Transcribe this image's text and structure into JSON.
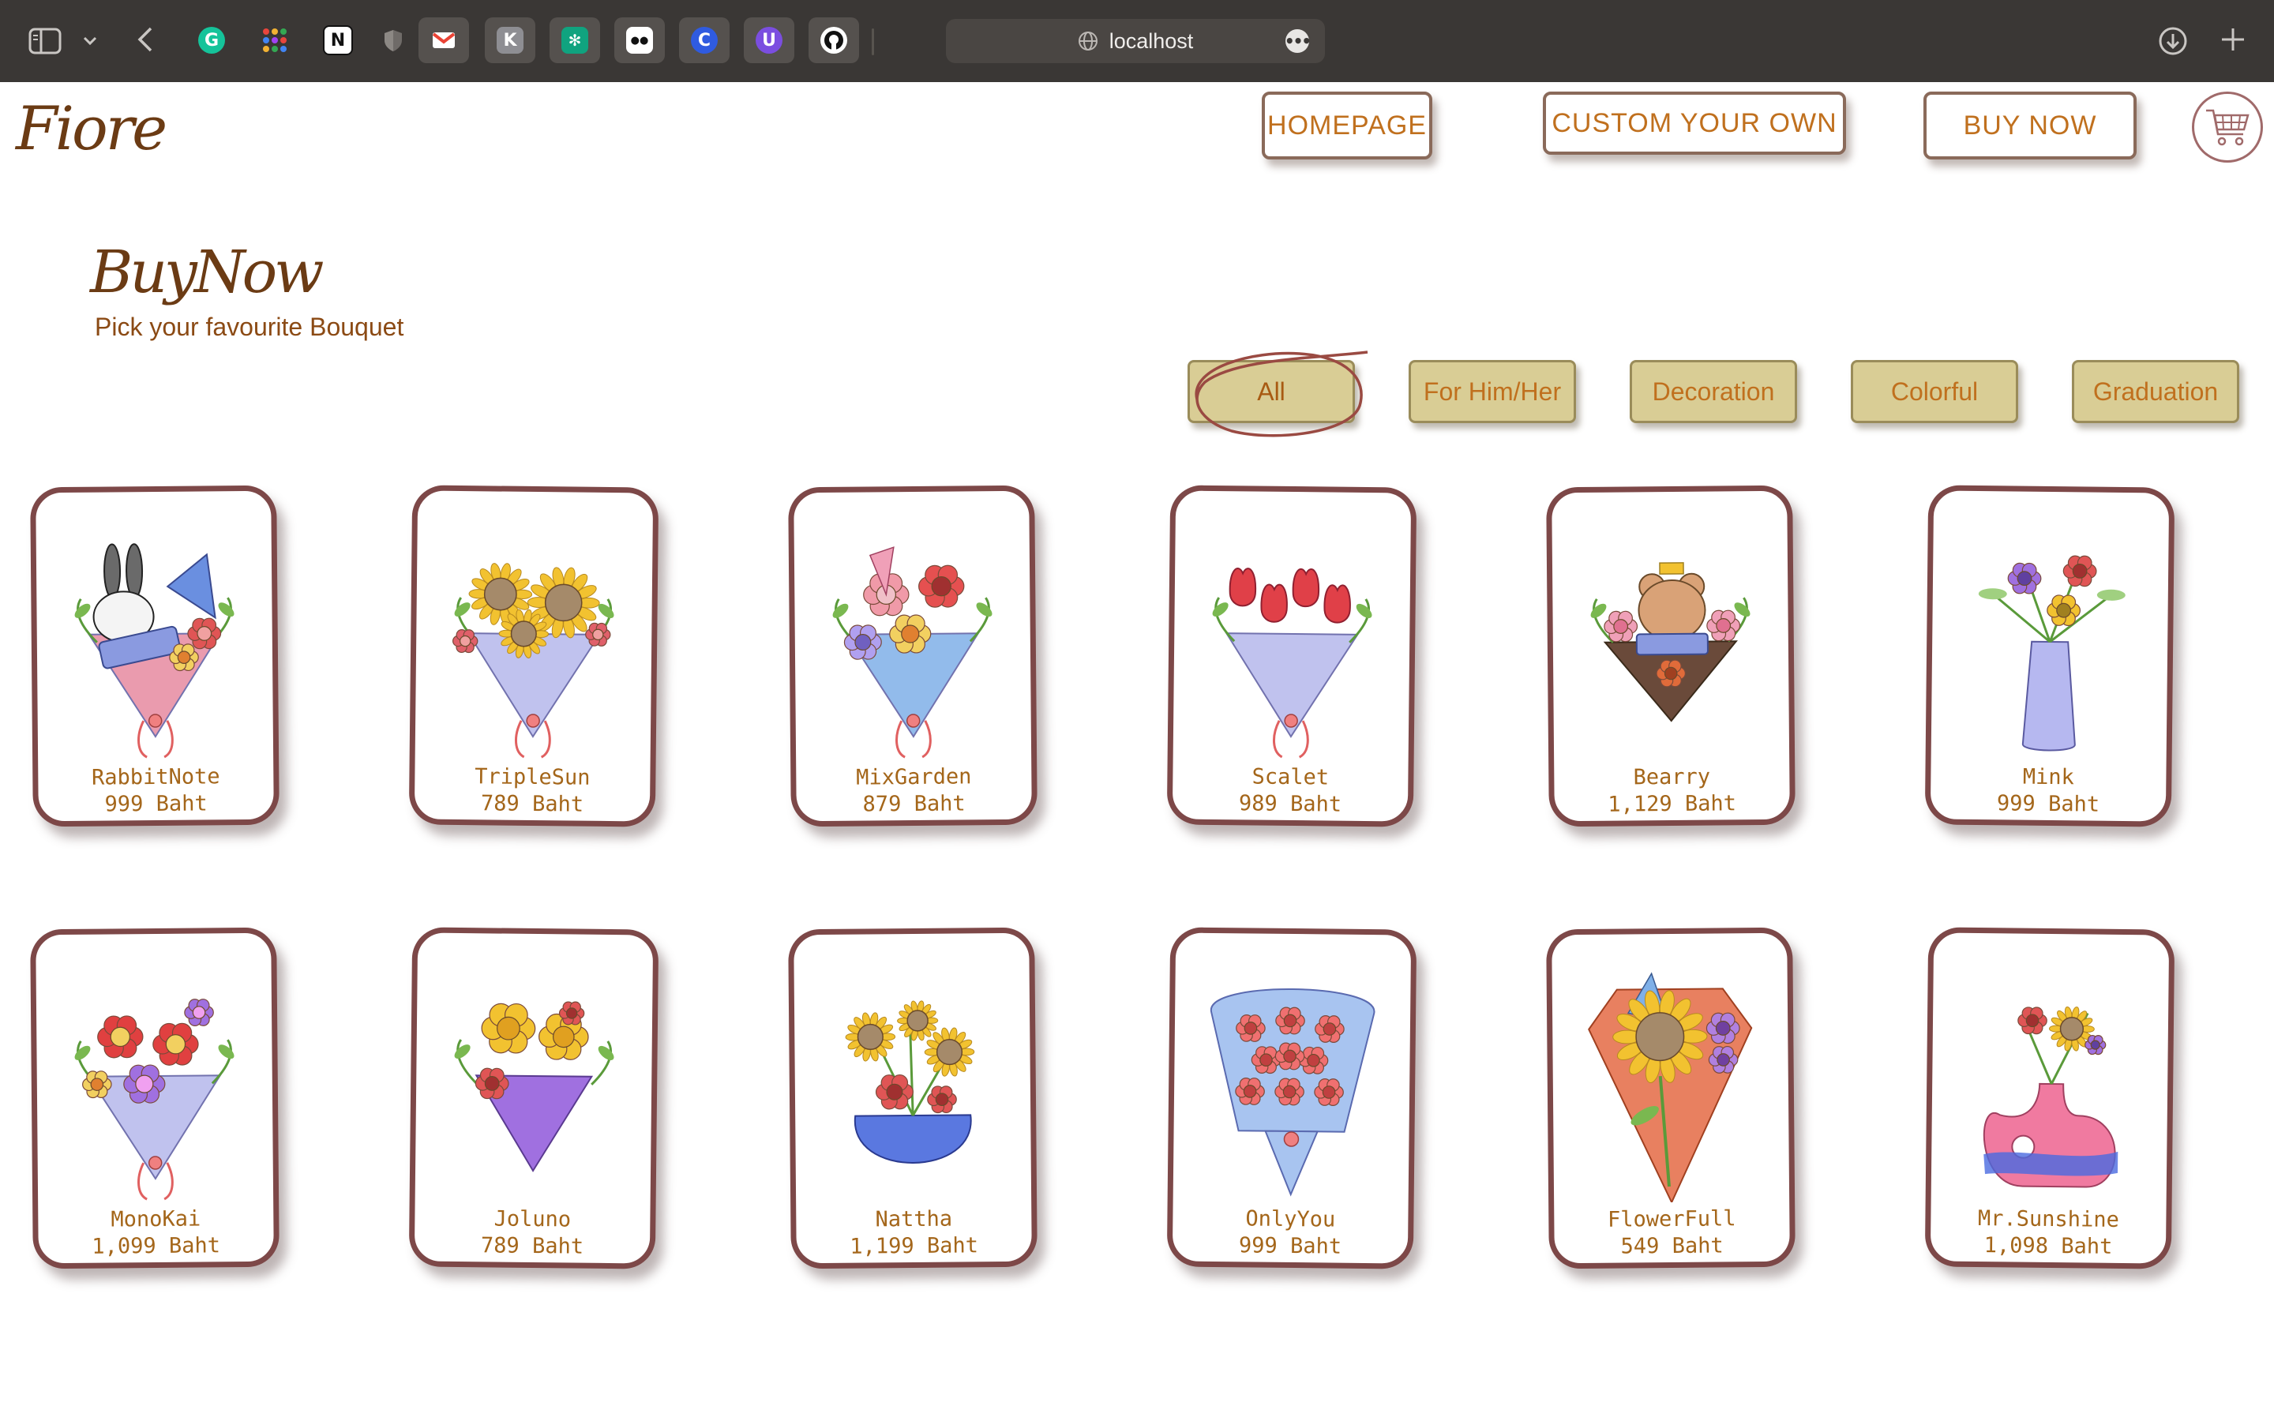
{
  "browser": {
    "url": "localhost",
    "tabs": [
      {
        "icon": "grammarly-icon",
        "color": "#15c39a",
        "active": false
      },
      {
        "icon": "apps-grid-icon",
        "color": "#e8453c",
        "active": false
      },
      {
        "icon": "notion-icon",
        "color": "#ffffff",
        "active": false
      },
      {
        "icon": "shield-icon",
        "color": "#7a7673",
        "active": false
      },
      {
        "icon": "gmail-icon",
        "color": "#ea4335",
        "active": true
      },
      {
        "icon": "k-app-icon",
        "color": "#8e8e93",
        "active": true
      },
      {
        "icon": "chatgpt-icon",
        "color": "#10a37f",
        "active": true
      },
      {
        "icon": "medium-icon",
        "color": "#111111",
        "active": true
      },
      {
        "icon": "c-app-icon",
        "color": "#2f5be0",
        "active": true
      },
      {
        "icon": "proton-icon",
        "color": "#7b4ee0",
        "active": true
      },
      {
        "icon": "github-icon",
        "color": "#111111",
        "active": true
      }
    ]
  },
  "header": {
    "logo": "Fiore",
    "nav": [
      "HOMEPAGE",
      "CUSTOM YOUR OWN",
      "BUY NOW"
    ],
    "cart_icon": "cart-icon"
  },
  "page": {
    "title": "BuyNow",
    "subtitle": "Pick your favourite Bouquet"
  },
  "filters": {
    "selected": "All",
    "items": [
      "All",
      "For Him/Her",
      "Decoration",
      "Colorful",
      "Graduation"
    ]
  },
  "products": [
    {
      "name": "RabbitNote",
      "price": "999 Baht",
      "art": "rabbit",
      "colors": [
        "#e78aa0",
        "#6a8fe0",
        "#e05555"
      ]
    },
    {
      "name": "TripleSun",
      "price": "789 Baht",
      "art": "sunflower",
      "colors": [
        "#f2c230",
        "#b6b8ec",
        "#e0606a"
      ]
    },
    {
      "name": "MixGarden",
      "price": "879 Baht",
      "art": "mix",
      "colors": [
        "#f09aa8",
        "#7fb0e8",
        "#e55050"
      ]
    },
    {
      "name": "Scalet",
      "price": "989 Baht",
      "art": "tulip",
      "colors": [
        "#e04048",
        "#b6b8ec",
        "#f2a0c0"
      ]
    },
    {
      "name": "Bearry",
      "price": "1,129 Baht",
      "art": "bear",
      "colors": [
        "#d9a277",
        "#f0a0b8",
        "#e06b3a"
      ]
    },
    {
      "name": "Mink",
      "price": "999 Baht",
      "art": "vase",
      "colors": [
        "#b6b8f0",
        "#e05555",
        "#f2c230"
      ]
    },
    {
      "name": "MonoKai",
      "price": "1,099 Baht",
      "art": "hibiscus",
      "colors": [
        "#e04040",
        "#a070e0",
        "#f2d060"
      ]
    },
    {
      "name": "Joluno",
      "price": "789 Baht",
      "art": "lily",
      "colors": [
        "#f2c230",
        "#a070e0",
        "#e05555"
      ]
    },
    {
      "name": "Nattha",
      "price": "1,199 Baht",
      "art": "pot",
      "colors": [
        "#5a78e0",
        "#f2c230",
        "#e05555"
      ]
    },
    {
      "name": "OnlyYou",
      "price": "999 Baht",
      "art": "roses",
      "colors": [
        "#a8c4f0",
        "#f07070",
        "#ffffff"
      ]
    },
    {
      "name": "FlowerFull",
      "price": "549 Baht",
      "art": "bigsun",
      "colors": [
        "#e88060",
        "#f2c230",
        "#b080e0"
      ]
    },
    {
      "name": "Mr.Sunshine",
      "price": "1,098 Baht",
      "art": "donut",
      "colors": [
        "#f07aa0",
        "#f2c230",
        "#4a6ae0"
      ]
    }
  ]
}
